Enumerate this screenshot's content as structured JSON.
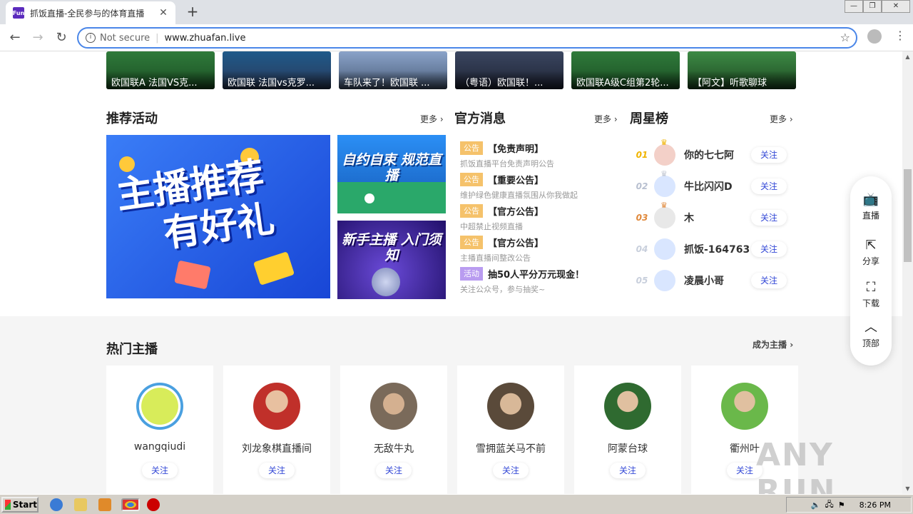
{
  "browser": {
    "tab_title": "抓饭直播-全民参与的体育直播",
    "favicon_text": "Fun",
    "new_tab": "+",
    "not_secure": "Not secure",
    "url": "www.zhuafan.live"
  },
  "videos": [
    {
      "caption": "欧国联A 法国VS克..."
    },
    {
      "caption": "欧国联 法国vs克罗..."
    },
    {
      "caption": "车队来了！欧国联 ..."
    },
    {
      "caption": "（粤语）欧国联！..."
    },
    {
      "caption": "欧国联A级C组第2轮..."
    },
    {
      "caption": "【阿文】听歌聊球"
    }
  ],
  "sections": {
    "activities": {
      "title": "推荐活动",
      "more": "更多"
    },
    "official": {
      "title": "官方消息",
      "more": "更多"
    },
    "weekly": {
      "title": "周星榜",
      "more": "更多"
    },
    "hot": {
      "title": "热门主播",
      "more": "成为主播"
    }
  },
  "banners": {
    "big_line1": "主播推荐",
    "big_line2": "有好礼",
    "small1": "自约自束 规范直播",
    "small2": "新手主播 入门须知"
  },
  "notices": [
    {
      "tag": "公告",
      "tag_color": "#f5c26b",
      "title": "【免责声明】",
      "subtitle": "抓饭直播平台免责声明公告"
    },
    {
      "tag": "公告",
      "tag_color": "#f5c26b",
      "title": "【重要公告】",
      "subtitle": "维护绿色健康直播氛围从你我做起"
    },
    {
      "tag": "公告",
      "tag_color": "#f5c26b",
      "title": "【官方公告】",
      "subtitle": "中超禁止视频直播"
    },
    {
      "tag": "公告",
      "tag_color": "#f5c26b",
      "title": "【官方公告】",
      "subtitle": "主播直播间整改公告"
    },
    {
      "tag": "活动",
      "tag_color": "#b99cf0",
      "title": "抽50人平分万元现金！",
      "subtitle": "关注公众号，参与抽奖~"
    }
  ],
  "weekly_stars": [
    {
      "rank": "01",
      "name": "你的七七阿",
      "follow": "关注",
      "rank_color": "#f0b400"
    },
    {
      "rank": "02",
      "name": "牛比闪闪D",
      "follow": "关注",
      "rank_color": "#b8c0d0"
    },
    {
      "rank": "03",
      "name": "木",
      "follow": "关注",
      "rank_color": "#e0883a"
    },
    {
      "rank": "04",
      "name": "抓饭-164763",
      "follow": "关注",
      "rank_color": "#c8cfdc"
    },
    {
      "rank": "05",
      "name": "凌晨小哥",
      "follow": "关注",
      "rank_color": "#c8cfdc"
    }
  ],
  "anchors": [
    {
      "name": "wangqiudi",
      "follow": "关注",
      "avatar_color": "#c8e04a"
    },
    {
      "name": "刘龙象棋直播间",
      "follow": "关注",
      "avatar_color": "#c0302a"
    },
    {
      "name": "无敌牛丸",
      "follow": "关注",
      "avatar_color": "#b59a80"
    },
    {
      "name": "雪拥蓝关马不前",
      "follow": "关注",
      "avatar_color": "#8a6a50"
    },
    {
      "name": "阿蒙台球",
      "follow": "关注",
      "avatar_color": "#3a6a3a"
    },
    {
      "name": "衢州叶",
      "follow": "关注",
      "avatar_color": "#5aa040"
    }
  ],
  "float_bar": [
    {
      "icon": "tv-icon",
      "label": "直播"
    },
    {
      "icon": "share-icon",
      "label": "分享"
    },
    {
      "icon": "download-icon",
      "label": "下载"
    },
    {
      "icon": "chevron-up-icon",
      "label": "顶部"
    }
  ],
  "watermark": "ANY RUN",
  "taskbar": {
    "start": "Start",
    "time": "8:26 PM"
  }
}
